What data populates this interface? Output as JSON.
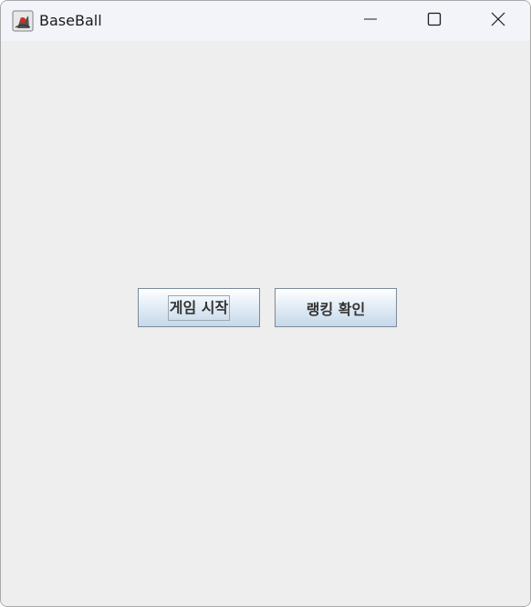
{
  "window": {
    "title": "BaseBall",
    "app_icon": "java-duke-icon"
  },
  "title_controls": {
    "minimize_icon": "minimize-icon",
    "maximize_icon": "maximize-icon",
    "close_icon": "close-icon"
  },
  "main": {
    "start_button_label": "게임 시작",
    "ranking_button_label": "랭킹 확인"
  },
  "colors": {
    "titlebar_bg": "#f3f4f9",
    "content_bg": "#eeeeee",
    "button_border": "#7a8a99",
    "button_gradient_bottom": "#c6d8ea"
  }
}
